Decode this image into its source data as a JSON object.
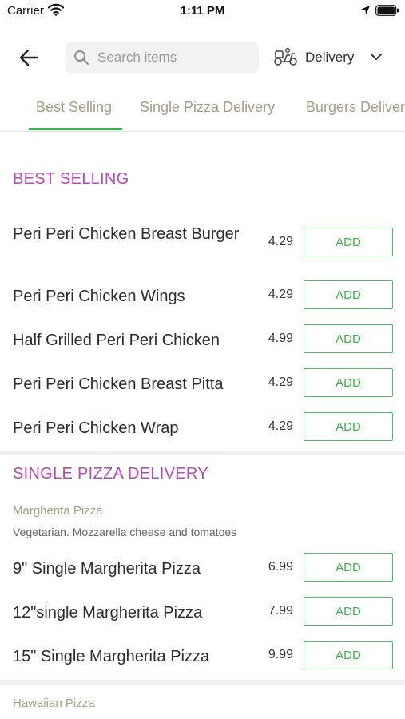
{
  "status_bar": {
    "carrier": "Carrier",
    "time": "1:11 PM"
  },
  "header": {
    "search_placeholder": "Search items",
    "delivery_label": "Delivery"
  },
  "tabs": [
    {
      "label": "Best Selling"
    },
    {
      "label": "Single Pizza Delivery"
    },
    {
      "label": "Burgers Delivery"
    }
  ],
  "colors": {
    "accent": "#3bb54a",
    "section": "#b24bb5",
    "tab_text": "#a59f87"
  },
  "best_selling": {
    "title": "BEST SELLING",
    "items": [
      {
        "name": "Peri Peri Chicken Breast Burger",
        "price": "4.29",
        "button": "ADD"
      },
      {
        "name": "Peri Peri Chicken Wings",
        "price": "4.29",
        "button": "ADD"
      },
      {
        "name": "Half Grilled Peri Peri Chicken",
        "price": "4.99",
        "button": "ADD"
      },
      {
        "name": "Peri Peri Chicken Breast Pitta",
        "price": "4.29",
        "button": "ADD"
      },
      {
        "name": "Peri Peri Chicken Wrap",
        "price": "4.29",
        "button": "ADD"
      }
    ]
  },
  "single_pizza": {
    "title": "SINGLE PIZZA DELIVERY",
    "subsection": "Margherita Pizza",
    "description": "Vegetarian. Mozzarella cheese and tomatoes",
    "items": [
      {
        "name": "9\" Single Margherita Pizza",
        "price": "6.99",
        "button": "ADD"
      },
      {
        "name": "12\"single Margherita Pizza",
        "price": "7.99",
        "button": "ADD"
      },
      {
        "name": "15\" Single Margherita Pizza",
        "price": "9.99",
        "button": "ADD"
      }
    ],
    "next_subsection": "Hawaiian Pizza"
  }
}
